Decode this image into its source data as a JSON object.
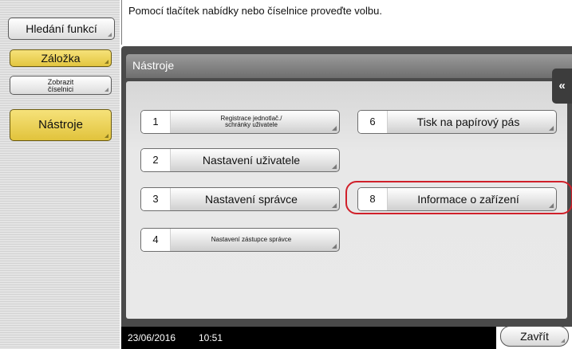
{
  "sidebar": {
    "search_label": "Hledání funkcí",
    "bookmark_label": "Záložka",
    "keypad_label_line1": "Zobrazit",
    "keypad_label_line2": "číselnici",
    "tools_label": "Nástroje"
  },
  "message": "Pomocí tlačítek nabídky nebo číselnice proveďte volbu.",
  "panel_title": "Nástroje",
  "collapse_icon": "«",
  "menu": [
    {
      "number": "1",
      "label_line1": "Registrace jednotlač./",
      "label_line2": "schránky uživatele"
    },
    {
      "number": "2",
      "label": "Nastavení uživatele"
    },
    {
      "number": "3",
      "label": "Nastavení správce"
    },
    {
      "number": "4",
      "label": "Nastavení zástupce správce"
    },
    {
      "number": "6",
      "label": "Tisk na papírový pás"
    },
    {
      "number": "8",
      "label": "Informace o zařízení"
    }
  ],
  "footer": {
    "date": "23/06/2016",
    "time": "10:51"
  },
  "close_label": "Zavřít",
  "colors": {
    "accent": "#e3c640",
    "highlight": "#d0202a",
    "frame": "#4a4a4a"
  }
}
